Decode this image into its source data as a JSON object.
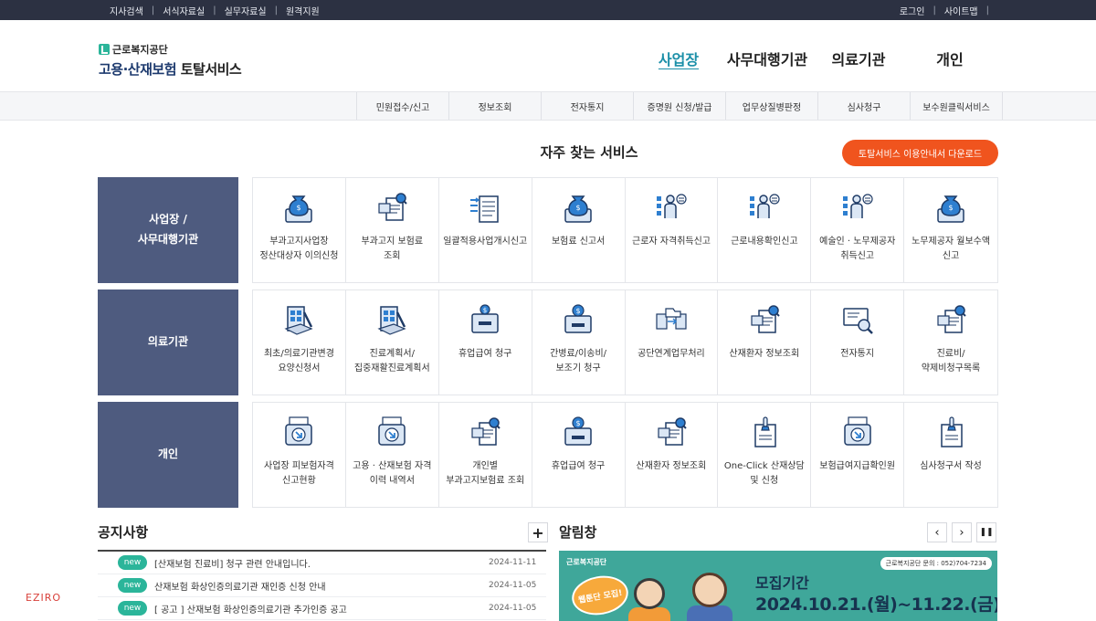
{
  "topbar": {
    "left": [
      "지사검색",
      "서식자료실",
      "실무자료실",
      "원격지원"
    ],
    "right": [
      "로그인",
      "사이트맵"
    ]
  },
  "logo": {
    "org": "근로복지공단",
    "title_main": "고용·산재보험",
    "title_sub": "토탈서비스"
  },
  "gnb": [
    "사업장",
    "사무대행기관",
    "의료기관",
    "개인"
  ],
  "subnav": [
    "민원접수/신고",
    "정보조회",
    "전자통지",
    "증명원 신청/발급",
    "업무상질병판정",
    "심사청구",
    "보수원클릭서비스"
  ],
  "main": {
    "title": "자주 찾는 서비스",
    "download_label": "토탈서비스 이용안내서 다운로드"
  },
  "rows": [
    {
      "category": "사업장 /\n사무대행기관",
      "items": [
        {
          "label": "부과고지사업장 정산대상자 이의신청",
          "icon": "money-bag-icon"
        },
        {
          "label": "부과고지 보험료 조회",
          "icon": "document-search-icon"
        },
        {
          "label": "일괄적용사업개시신고",
          "icon": "document-list-icon"
        },
        {
          "label": "보험료 신고서",
          "icon": "money-bag-icon"
        },
        {
          "label": "근로자 자격취득신고",
          "icon": "person-checklist-icon"
        },
        {
          "label": "근로내용확인신고",
          "icon": "person-checklist-icon"
        },
        {
          "label": "예술인 · 노무제공자 취득신고",
          "icon": "person-checklist-icon"
        },
        {
          "label": "노무제공자 월보수액 신고",
          "icon": "money-bag-icon"
        }
      ]
    },
    {
      "category": "의료기관",
      "items": [
        {
          "label": "최초/의료기관변경 요양신청서",
          "icon": "clipboard-pen-icon"
        },
        {
          "label": "진료계획서/집중재활진료계획서",
          "icon": "clipboard-pen-icon"
        },
        {
          "label": "휴업급여 청구",
          "icon": "inbox-icon"
        },
        {
          "label": "간병료/이송비/보조기 청구",
          "icon": "money-box-icon"
        },
        {
          "label": "공단연계업무처리",
          "icon": "folder-transfer-icon"
        },
        {
          "label": "산재환자 정보조회",
          "icon": "document-search-icon"
        },
        {
          "label": "전자통지",
          "icon": "monitor-search-icon"
        },
        {
          "label": "진료비/약제비청구목록",
          "icon": "document-search-icon"
        }
      ]
    },
    {
      "category": "개인",
      "items": [
        {
          "label": "사업장 피보험자격 신고현황",
          "icon": "printer-download-icon"
        },
        {
          "label": "고용 · 산재보험 자격 이력 내역서",
          "icon": "printer-download-icon"
        },
        {
          "label": "개인별 부과고지보험료 조회",
          "icon": "document-search-icon"
        },
        {
          "label": "휴업급여 청구",
          "icon": "money-box-icon"
        },
        {
          "label": "산재환자 정보조회",
          "icon": "document-search-icon"
        },
        {
          "label": "One-Click 산재상담 및 신청",
          "icon": "stamp-document-icon"
        },
        {
          "label": "보험급여지급확인원",
          "icon": "printer-download-icon"
        },
        {
          "label": "심사청구서 작성",
          "icon": "stamp-document-icon"
        }
      ]
    }
  ],
  "notice": {
    "title": "공지사항",
    "more": "+",
    "items": [
      {
        "badge": "new",
        "text": "[산재보험 진료비] 청구 관련 안내입니다.",
        "date": "2024-11-11"
      },
      {
        "badge": "new",
        "text": "산재보험 화상인증의료기관 재인증 신청 안내",
        "date": "2024-11-05"
      },
      {
        "badge": "new",
        "text": "[ 공고 ] 산재보험 화상인증의료기관 추가인증 공고",
        "date": "2024-11-05"
      }
    ]
  },
  "alert": {
    "title": "알림창",
    "prev": "‹",
    "next": "›",
    "pause": "❚❚",
    "banner": {
      "logo": "근로복지공단",
      "contact": "근로복지공단 문의 : 052)704-7234",
      "sticker": "웹툰단 모집!",
      "title": "모집기간",
      "date": "2024.10.21.(월)~11.22.(금)"
    }
  },
  "watermark": "EZIRO",
  "colors": {
    "topbar": "#2c3142",
    "category": "#4e5b7f",
    "accent": "#1b8fa8",
    "download": "#f0541e",
    "badge": "#2bb59a",
    "banner": "#3fa79a"
  }
}
